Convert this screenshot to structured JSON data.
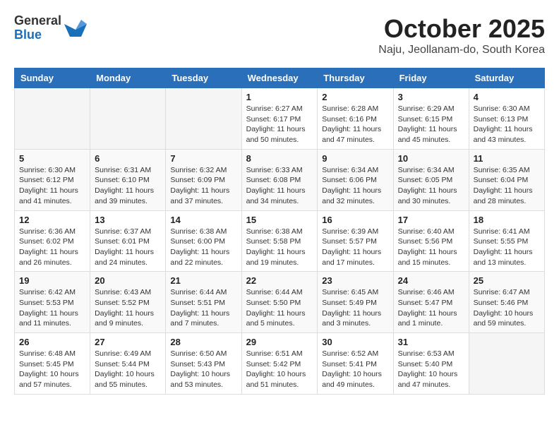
{
  "logo": {
    "general": "General",
    "blue": "Blue"
  },
  "title": "October 2025",
  "location": "Naju, Jeollanam-do, South Korea",
  "weekdays": [
    "Sunday",
    "Monday",
    "Tuesday",
    "Wednesday",
    "Thursday",
    "Friday",
    "Saturday"
  ],
  "weeks": [
    [
      {
        "day": "",
        "info": ""
      },
      {
        "day": "",
        "info": ""
      },
      {
        "day": "",
        "info": ""
      },
      {
        "day": "1",
        "info": "Sunrise: 6:27 AM\nSunset: 6:17 PM\nDaylight: 11 hours\nand 50 minutes."
      },
      {
        "day": "2",
        "info": "Sunrise: 6:28 AM\nSunset: 6:16 PM\nDaylight: 11 hours\nand 47 minutes."
      },
      {
        "day": "3",
        "info": "Sunrise: 6:29 AM\nSunset: 6:15 PM\nDaylight: 11 hours\nand 45 minutes."
      },
      {
        "day": "4",
        "info": "Sunrise: 6:30 AM\nSunset: 6:13 PM\nDaylight: 11 hours\nand 43 minutes."
      }
    ],
    [
      {
        "day": "5",
        "info": "Sunrise: 6:30 AM\nSunset: 6:12 PM\nDaylight: 11 hours\nand 41 minutes."
      },
      {
        "day": "6",
        "info": "Sunrise: 6:31 AM\nSunset: 6:10 PM\nDaylight: 11 hours\nand 39 minutes."
      },
      {
        "day": "7",
        "info": "Sunrise: 6:32 AM\nSunset: 6:09 PM\nDaylight: 11 hours\nand 37 minutes."
      },
      {
        "day": "8",
        "info": "Sunrise: 6:33 AM\nSunset: 6:08 PM\nDaylight: 11 hours\nand 34 minutes."
      },
      {
        "day": "9",
        "info": "Sunrise: 6:34 AM\nSunset: 6:06 PM\nDaylight: 11 hours\nand 32 minutes."
      },
      {
        "day": "10",
        "info": "Sunrise: 6:34 AM\nSunset: 6:05 PM\nDaylight: 11 hours\nand 30 minutes."
      },
      {
        "day": "11",
        "info": "Sunrise: 6:35 AM\nSunset: 6:04 PM\nDaylight: 11 hours\nand 28 minutes."
      }
    ],
    [
      {
        "day": "12",
        "info": "Sunrise: 6:36 AM\nSunset: 6:02 PM\nDaylight: 11 hours\nand 26 minutes."
      },
      {
        "day": "13",
        "info": "Sunrise: 6:37 AM\nSunset: 6:01 PM\nDaylight: 11 hours\nand 24 minutes."
      },
      {
        "day": "14",
        "info": "Sunrise: 6:38 AM\nSunset: 6:00 PM\nDaylight: 11 hours\nand 22 minutes."
      },
      {
        "day": "15",
        "info": "Sunrise: 6:38 AM\nSunset: 5:58 PM\nDaylight: 11 hours\nand 19 minutes."
      },
      {
        "day": "16",
        "info": "Sunrise: 6:39 AM\nSunset: 5:57 PM\nDaylight: 11 hours\nand 17 minutes."
      },
      {
        "day": "17",
        "info": "Sunrise: 6:40 AM\nSunset: 5:56 PM\nDaylight: 11 hours\nand 15 minutes."
      },
      {
        "day": "18",
        "info": "Sunrise: 6:41 AM\nSunset: 5:55 PM\nDaylight: 11 hours\nand 13 minutes."
      }
    ],
    [
      {
        "day": "19",
        "info": "Sunrise: 6:42 AM\nSunset: 5:53 PM\nDaylight: 11 hours\nand 11 minutes."
      },
      {
        "day": "20",
        "info": "Sunrise: 6:43 AM\nSunset: 5:52 PM\nDaylight: 11 hours\nand 9 minutes."
      },
      {
        "day": "21",
        "info": "Sunrise: 6:44 AM\nSunset: 5:51 PM\nDaylight: 11 hours\nand 7 minutes."
      },
      {
        "day": "22",
        "info": "Sunrise: 6:44 AM\nSunset: 5:50 PM\nDaylight: 11 hours\nand 5 minutes."
      },
      {
        "day": "23",
        "info": "Sunrise: 6:45 AM\nSunset: 5:49 PM\nDaylight: 11 hours\nand 3 minutes."
      },
      {
        "day": "24",
        "info": "Sunrise: 6:46 AM\nSunset: 5:47 PM\nDaylight: 11 hours\nand 1 minute."
      },
      {
        "day": "25",
        "info": "Sunrise: 6:47 AM\nSunset: 5:46 PM\nDaylight: 10 hours\nand 59 minutes."
      }
    ],
    [
      {
        "day": "26",
        "info": "Sunrise: 6:48 AM\nSunset: 5:45 PM\nDaylight: 10 hours\nand 57 minutes."
      },
      {
        "day": "27",
        "info": "Sunrise: 6:49 AM\nSunset: 5:44 PM\nDaylight: 10 hours\nand 55 minutes."
      },
      {
        "day": "28",
        "info": "Sunrise: 6:50 AM\nSunset: 5:43 PM\nDaylight: 10 hours\nand 53 minutes."
      },
      {
        "day": "29",
        "info": "Sunrise: 6:51 AM\nSunset: 5:42 PM\nDaylight: 10 hours\nand 51 minutes."
      },
      {
        "day": "30",
        "info": "Sunrise: 6:52 AM\nSunset: 5:41 PM\nDaylight: 10 hours\nand 49 minutes."
      },
      {
        "day": "31",
        "info": "Sunrise: 6:53 AM\nSunset: 5:40 PM\nDaylight: 10 hours\nand 47 minutes."
      },
      {
        "day": "",
        "info": ""
      }
    ]
  ]
}
